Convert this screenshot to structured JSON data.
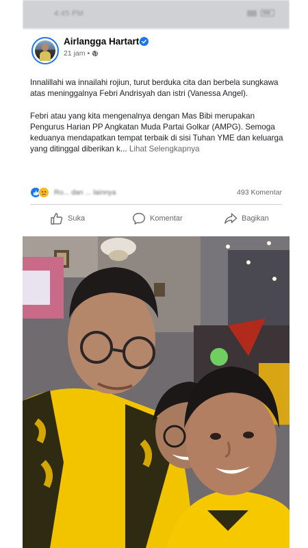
{
  "status_bar": {
    "time": "4:45 PM"
  },
  "post": {
    "author": "Airlangga Hartarto",
    "time_ago": "21 jam",
    "separator": "•",
    "paragraph_1": "Innalillahi wa innailahi rojiun, turut berduka cita dan berbela sungkawa atas meninggalnya Febri Andrisyah dan istri (Vanessa Angel).",
    "paragraph_2": "Febri atau yang kita mengenalnya dengan Mas Bibi merupakan Pengurus Harian PP Angkatan Muda Partai Golkar (AMPG). Semoga keduanya mendapatkan tempat terbaik di sisi Tuhan YME dan keluarga yang ditinggal diberikan k...",
    "see_more": "Lihat Selengkapnya",
    "reaction_summary": "Ro... dan ... lainnya",
    "comment_count": "493 Komentar"
  },
  "actions": {
    "like_label": "Suka",
    "comment_label": "Komentar",
    "share_label": "Bagikan"
  },
  "icons": {
    "verified": "verified-badge-icon",
    "globe": "globe-icon",
    "like_reaction": "like-reaction-icon",
    "sad_reaction": "sad-reaction-icon",
    "like_action": "thumbs-up-icon",
    "comment_action": "speech-bubble-icon",
    "share_action": "share-arrow-icon"
  },
  "colors": {
    "brand_blue": "#1877f2",
    "secondary_text": "#65676b",
    "golkar_yellow": "#f2c500"
  }
}
